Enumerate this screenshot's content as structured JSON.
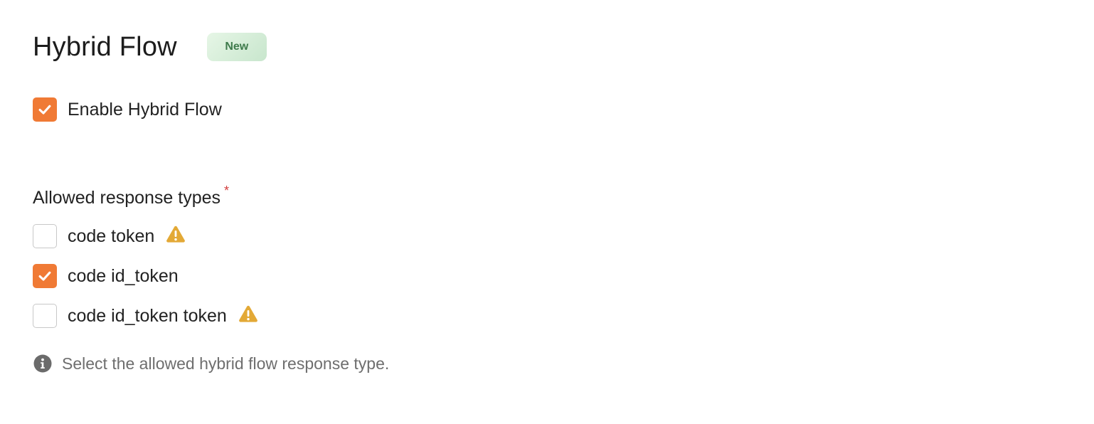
{
  "section": {
    "title": "Hybrid Flow",
    "badge": "New"
  },
  "enable": {
    "label": "Enable Hybrid Flow",
    "checked": true
  },
  "response_types": {
    "label": "Allowed response types",
    "required_mark": "*",
    "options": [
      {
        "label": "code token",
        "checked": false,
        "warning": true
      },
      {
        "label": "code id_token",
        "checked": true,
        "warning": false
      },
      {
        "label": "code id_token token",
        "checked": false,
        "warning": true
      }
    ],
    "hint": "Select the allowed hybrid flow response type."
  },
  "colors": {
    "accent": "#f07a35",
    "warning": "#e3a936",
    "badge_text": "#3f7b4c",
    "badge_bg": "#d6efd9",
    "required": "#d23b3b",
    "hint_text": "#6e6e6e"
  },
  "icons": {
    "check": "checkmark-icon",
    "warning": "warning-triangle-icon",
    "info": "info-circle-icon"
  }
}
